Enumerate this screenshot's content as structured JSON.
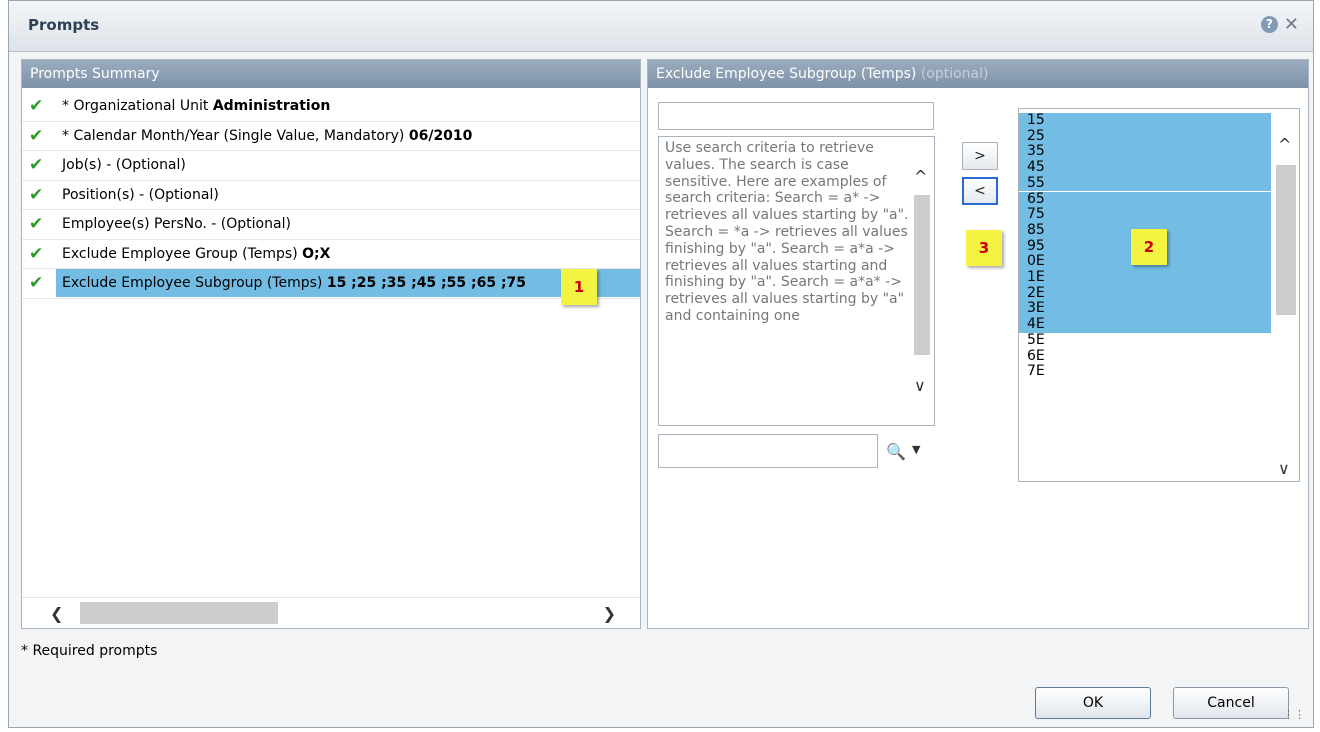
{
  "window": {
    "title": "Prompts",
    "help_icon": "?",
    "close_icon": "✕"
  },
  "summary": {
    "header": "Prompts Summary",
    "rows": [
      {
        "label": "* Organizational Unit ",
        "value": "Administration"
      },
      {
        "label": "* Calendar Month/Year (Single Value, Mandatory) ",
        "value": "06/2010"
      },
      {
        "label": "Job(s) - (Optional)",
        "value": ""
      },
      {
        "label": "Position(s) - (Optional)",
        "value": ""
      },
      {
        "label": "Employee(s) PersNo. - (Optional)",
        "value": ""
      },
      {
        "label": "Exclude Employee Group (Temps) ",
        "value": "O;X"
      },
      {
        "label": "Exclude Employee Subgroup (Temps) ",
        "value": "15 ;25 ;35 ;45 ;55 ;65 ;75"
      }
    ],
    "selected_row": 6,
    "check_icon": "✔"
  },
  "detail": {
    "header": "Exclude Employee Subgroup (Temps)",
    "header_optional": " (optional)",
    "help_text": "Use search criteria to retrieve values. The search is case sensitive. Here are examples of search criteria: Search = a* -> retrieves all values starting by \"a\". Search = *a -> retrieves all values finishing by \"a\". Search = a*a -> retrieves all values starting and finishing by \"a\". Search = a*a* -> retrieves all values starting by \"a\" and containing one",
    "add_label": ">",
    "remove_label": "<",
    "values": [
      "15",
      "25",
      "35",
      "45",
      "55",
      "65",
      "75",
      "85",
      "95",
      "0E",
      "1E",
      "2E",
      "3E",
      "4E",
      "5E",
      "6E",
      "7E"
    ],
    "selected_count": 14
  },
  "callouts": {
    "c1": "1",
    "c2": "2",
    "c3": "3"
  },
  "footer": {
    "required_note": "* Required prompts",
    "ok_label": "OK",
    "cancel_label": "Cancel"
  }
}
